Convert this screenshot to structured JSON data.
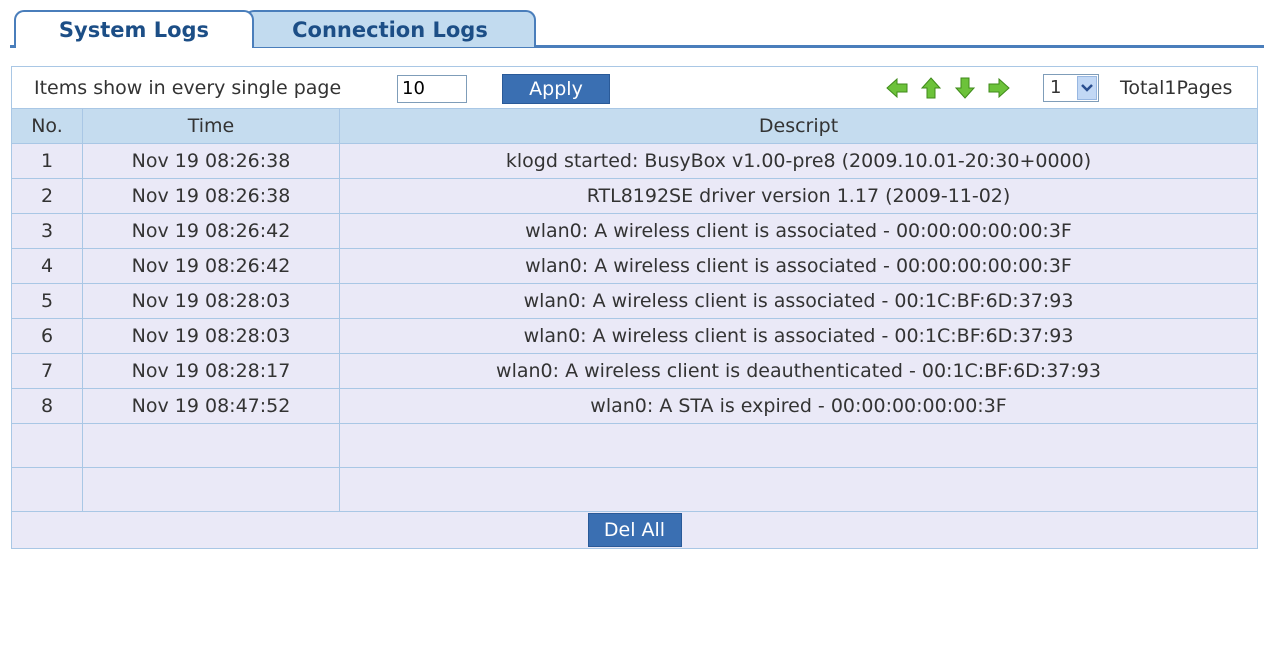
{
  "tabs": [
    {
      "label": "System Logs",
      "active": true
    },
    {
      "label": "Connection Logs",
      "active": false
    }
  ],
  "toolbar": {
    "items_label": "Items show in every single page",
    "items_value": "10",
    "apply_label": "Apply",
    "nav_icons": [
      "prev-arrow-icon",
      "first-arrow-icon",
      "last-arrow-icon",
      "next-arrow-icon"
    ],
    "page_selected": "1",
    "total_pages": "Total1Pages"
  },
  "table": {
    "headers": [
      "No.",
      "Time",
      "Descript"
    ],
    "rows": [
      {
        "no": "1",
        "time": "Nov 19 08:26:38",
        "desc": "klogd started: BusyBox v1.00-pre8 (2009.10.01-20:30+0000)"
      },
      {
        "no": "2",
        "time": "Nov 19 08:26:38",
        "desc": "RTL8192SE driver version 1.17 (2009-11-02)"
      },
      {
        "no": "3",
        "time": "Nov 19 08:26:42",
        "desc": "wlan0: A wireless client is associated - 00:00:00:00:00:3F"
      },
      {
        "no": "4",
        "time": "Nov 19 08:26:42",
        "desc": "wlan0: A wireless client is associated - 00:00:00:00:00:3F"
      },
      {
        "no": "5",
        "time": "Nov 19 08:28:03",
        "desc": "wlan0: A wireless client is associated - 00:1C:BF:6D:37:93"
      },
      {
        "no": "6",
        "time": "Nov 19 08:28:03",
        "desc": "wlan0: A wireless client is associated - 00:1C:BF:6D:37:93"
      },
      {
        "no": "7",
        "time": "Nov 19 08:28:17",
        "desc": "wlan0: A wireless client is deauthenticated - 00:1C:BF:6D:37:93"
      },
      {
        "no": "8",
        "time": "Nov 19 08:47:52",
        "desc": "wlan0: A STA is expired - 00:00:00:00:00:3F"
      }
    ]
  },
  "footer": {
    "del_all_label": "Del All"
  },
  "colors": {
    "accent": "#3a6fb2",
    "header_bg": "#c5dcef",
    "row_bg": "#eae9f7",
    "arrow_green": "#5cb82e"
  }
}
